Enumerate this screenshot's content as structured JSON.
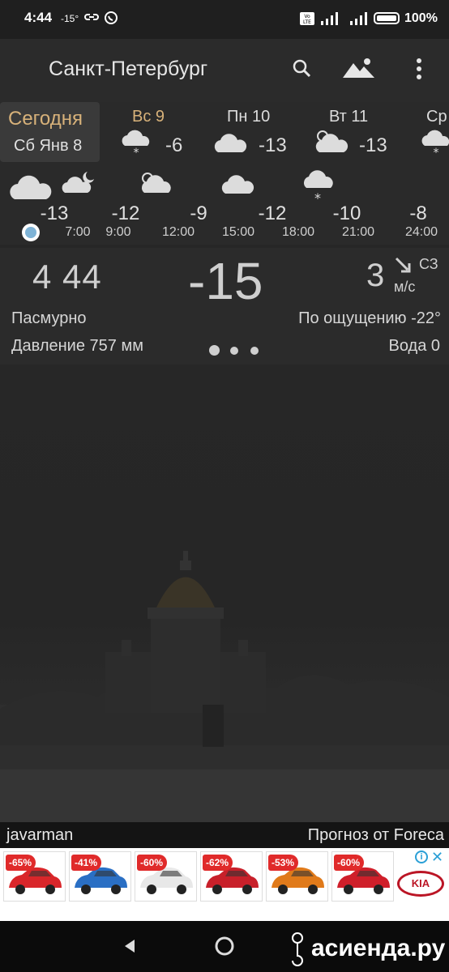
{
  "status_bar": {
    "time": "4:44",
    "temp_notification": "-15°",
    "battery_percent": "100%"
  },
  "app_bar": {
    "city": "Санкт-Петербург"
  },
  "days": {
    "today": {
      "line1": "Сегодня",
      "line2": "Сб Янв 8"
    },
    "items": [
      {
        "label": "Вс 9",
        "temp": "-6",
        "icon": "cloud-snow-icon"
      },
      {
        "label": "Пн 10",
        "temp": "-13",
        "icon": "cloud-icon"
      },
      {
        "label": "Вт 11",
        "temp": "-13",
        "icon": "partly-cloudy-icon"
      },
      {
        "label": "Ср",
        "temp": "",
        "icon": "cloud-snow-icon"
      }
    ]
  },
  "hourly": {
    "temps": [
      "-13",
      "-12",
      "-9",
      "-12",
      "-10",
      "-8"
    ],
    "times": [
      "7:00",
      "9:00",
      "12:00",
      "15:00",
      "18:00",
      "21:00",
      "24:00"
    ]
  },
  "current": {
    "time": "4 44",
    "temp": "-15",
    "wind_speed": "3",
    "wind_unit": "м/с",
    "wind_direction": "СЗ",
    "condition": "Пасмурно",
    "feels_like": "По ощущению -22°",
    "pressure": "Давление 757 мм",
    "water": "Вода 0"
  },
  "footer": {
    "author": "javarman",
    "forecast_by": "Прогноз от Foreca"
  },
  "ad": {
    "discounts": [
      "-65%",
      "-41%",
      "-60%",
      "-62%",
      "-53%",
      "-60%"
    ],
    "car_colors": [
      "#d9262a",
      "#2a6fc4",
      "#e8e8e8",
      "#c8202a",
      "#e07a1a",
      "#cf1f2a"
    ],
    "brand": "KIA"
  },
  "watermark": "асиенда.ру"
}
